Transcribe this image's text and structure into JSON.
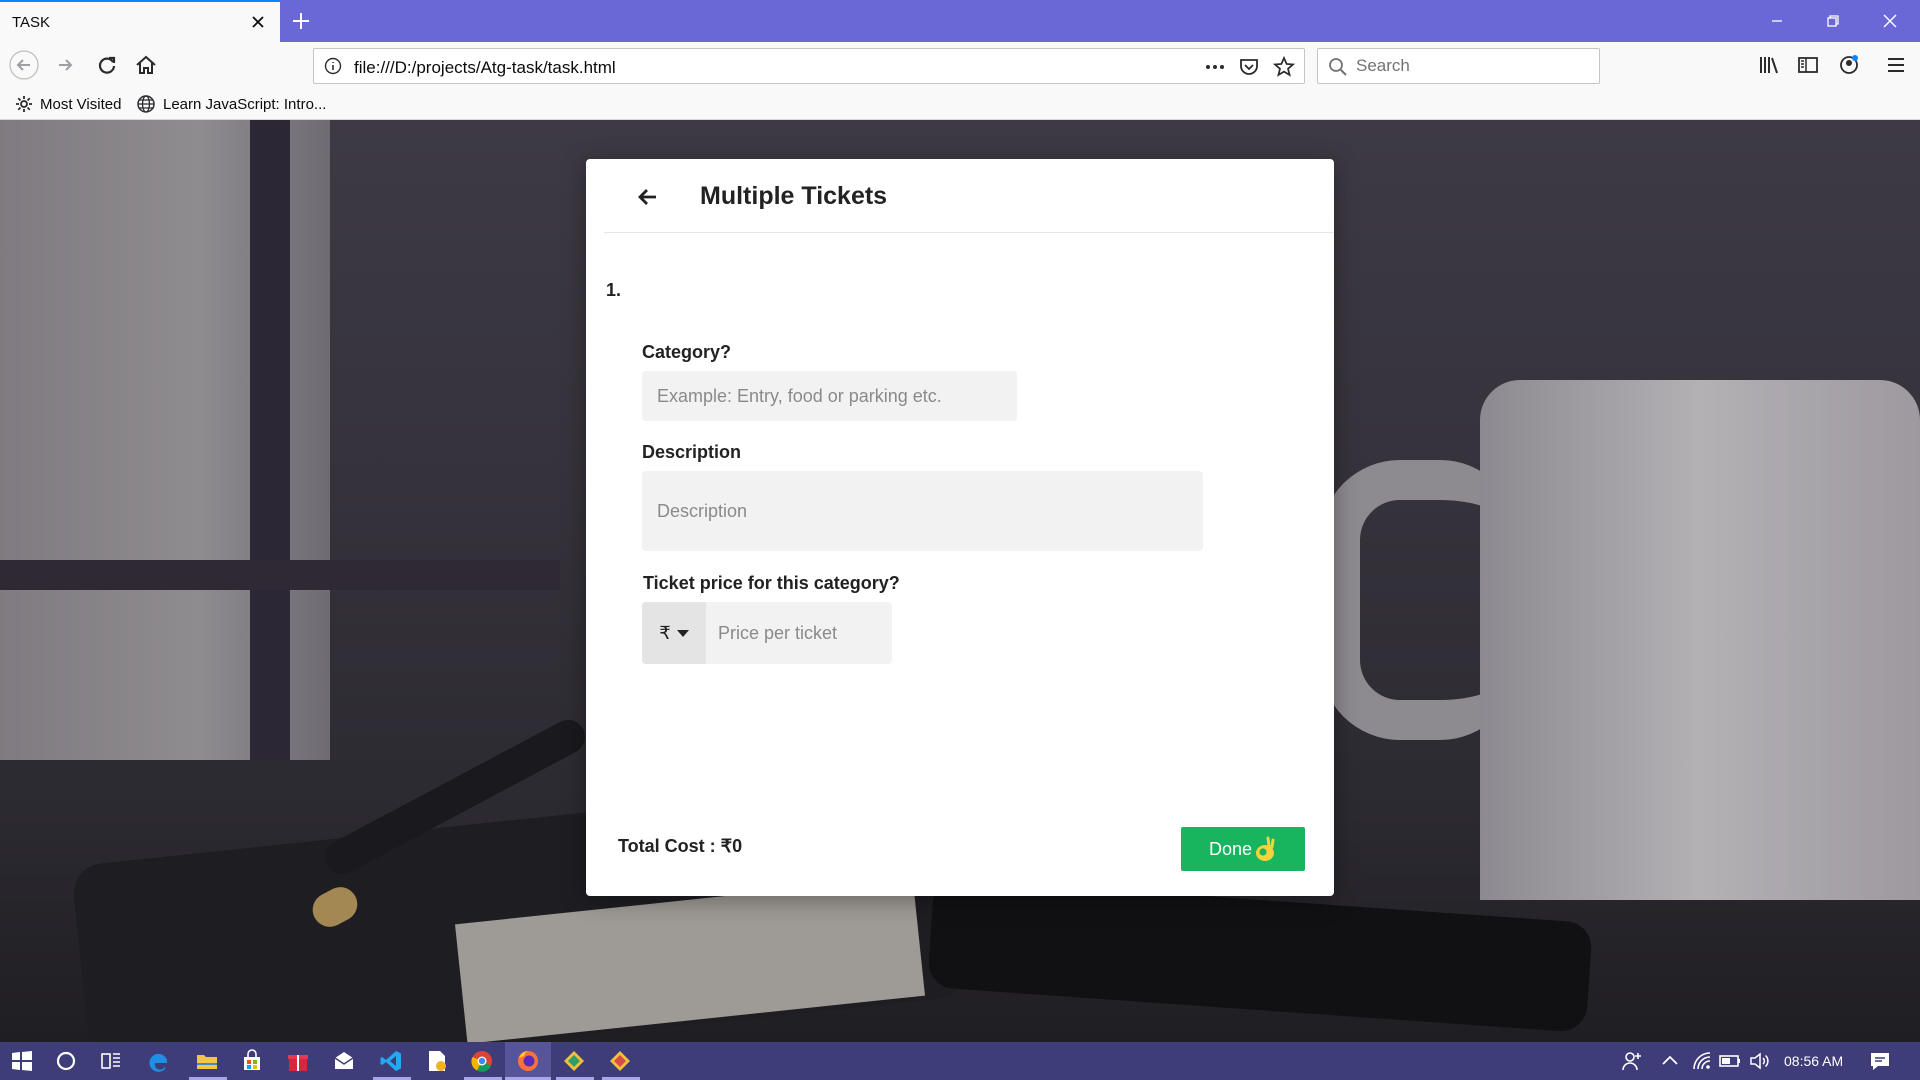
{
  "browser": {
    "tab_title": "TASK",
    "url": "file:///D:/projects/Atg-task/task.html",
    "search_placeholder": "Search",
    "bookmarks": [
      "Most Visited",
      "Learn JavaScript: Intro..."
    ]
  },
  "modal": {
    "title": "Multiple Tickets",
    "item_number": "1.",
    "category_label": "Category?",
    "category_placeholder": "Example: Entry, food or parking etc.",
    "description_label": "Description",
    "description_placeholder": "Description",
    "price_label": "Ticket price for this category?",
    "currency_symbol": "₹",
    "price_placeholder": "Price per ticket",
    "total_cost": "Total Cost : ₹0",
    "done_label": "Done"
  },
  "taskbar": {
    "time": "08:56 AM"
  },
  "colors": {
    "tabbar": "#6a67d6",
    "done_button": "#18b55e",
    "taskbar": "#3e3c79"
  }
}
